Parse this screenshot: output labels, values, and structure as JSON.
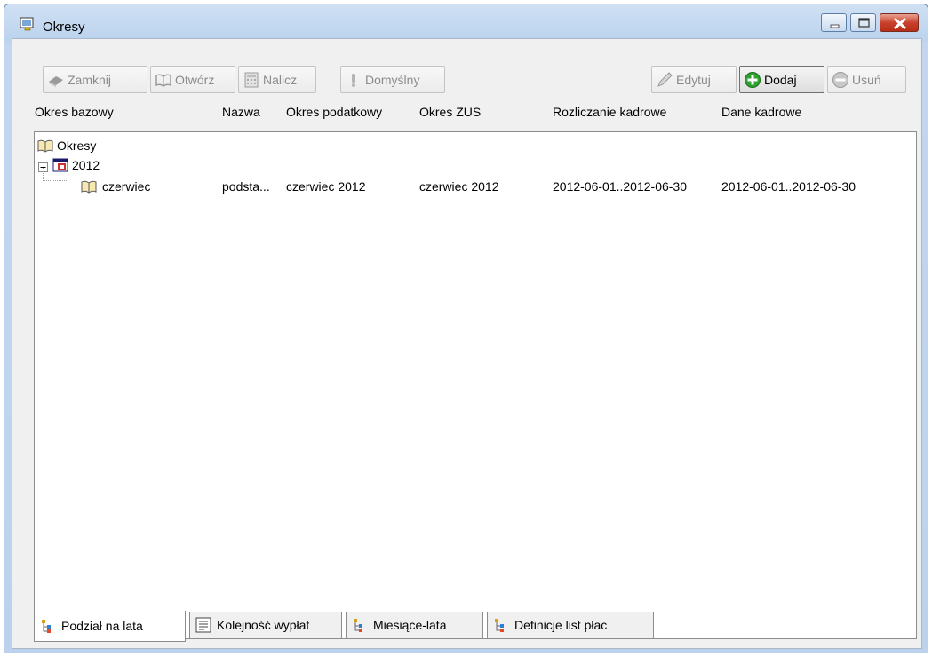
{
  "window": {
    "title": "Okresy",
    "controls": [
      "minimize-icon",
      "maximize-icon",
      "close-icon"
    ]
  },
  "toolbar": {
    "left_buttons": [
      {
        "label": "Zamknij",
        "icon": "close-book-icon",
        "enabled": false
      },
      {
        "label": "Otwórz",
        "icon": "open-book-icon",
        "enabled": false
      },
      {
        "label": "Nalicz",
        "icon": "calculator-icon",
        "enabled": false
      },
      {
        "label": "Domyślny",
        "icon": "exclamation-icon",
        "enabled": false
      }
    ],
    "right_buttons": [
      {
        "label": "Edytuj",
        "icon": "pencil-icon",
        "enabled": false
      },
      {
        "label": "Dodaj",
        "icon": "add-icon",
        "enabled": true
      },
      {
        "label": "Usuń",
        "icon": "remove-icon",
        "enabled": false
      }
    ]
  },
  "table": {
    "columns": [
      "Okres bazowy",
      "Nazwa",
      "Okres podatkowy",
      "Okres ZUS",
      "Rozliczanie kadrowe",
      "Dane kadrowe"
    ],
    "tree": {
      "root": "Okresy",
      "year": "2012",
      "row": {
        "okres_bazowy": "czerwiec",
        "nazwa": "podsta...",
        "okres_podatkowy": "czerwiec 2012",
        "okres_zus": "czerwiec 2012",
        "rozliczanie_kadrowe": "2012-06-01..2012-06-30",
        "dane_kadrowe": "2012-06-01..2012-06-30"
      }
    }
  },
  "tabs": [
    {
      "label": "Podział na lata",
      "icon": "tree-icon",
      "active": true
    },
    {
      "label": "Kolejność wypłat",
      "icon": "list-icon",
      "active": false
    },
    {
      "label": "Miesiące-lata",
      "icon": "tree-icon",
      "active": false
    },
    {
      "label": "Definicje list płac",
      "icon": "tree-icon",
      "active": false
    }
  ],
  "colors": {
    "title_gradient": "#bcd3ee",
    "close_button": "#c9412c",
    "add_icon": "#2ea12e",
    "calendar_red": "#d03030"
  }
}
